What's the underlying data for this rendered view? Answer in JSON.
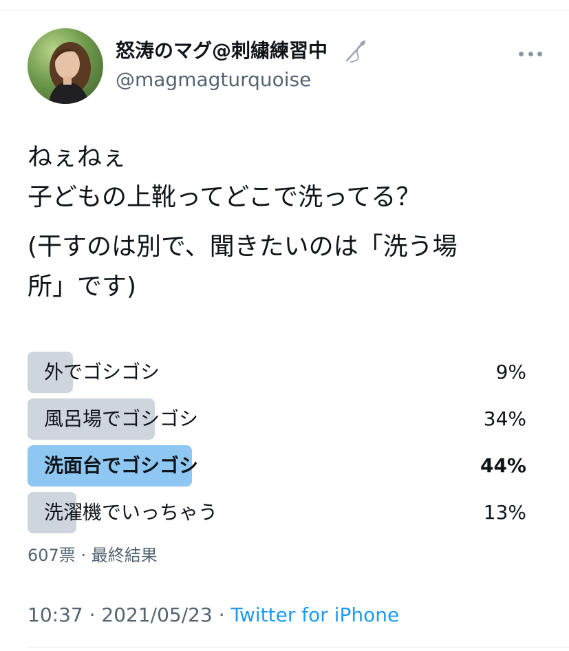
{
  "user": {
    "display_name": "怒涛のマグ@刺繍練習中",
    "handle": "@magmagturquoise"
  },
  "tweet": {
    "lines": [
      "ねぇねぇ",
      "子どもの上靴ってどこで洗ってる？",
      "(干すのは別で、聞きたいのは「洗う場",
      "所」です)"
    ]
  },
  "poll": {
    "options": [
      {
        "label": "外でゴシゴシ",
        "percent_label": "9%",
        "percent": 9
      },
      {
        "label": "風呂場でゴシゴシ",
        "percent_label": "34%",
        "percent": 34
      },
      {
        "label": "洗面台でゴシゴシ",
        "percent_label": "44%",
        "percent": 44,
        "winner": true
      },
      {
        "label": "洗濯機でいっちゃう",
        "percent_label": "13%",
        "percent": 13
      }
    ],
    "votes": "607票",
    "separator": "·",
    "status": "最終結果"
  },
  "meta": {
    "time": "10:37",
    "separator": "·",
    "date": "2021/05/23",
    "source": "Twitter for iPhone"
  },
  "colors": {
    "bar": "#cfd5dc",
    "winner_bar": "#8ec7f2",
    "link": "#1d9bf0",
    "secondary_text": "#536471"
  }
}
